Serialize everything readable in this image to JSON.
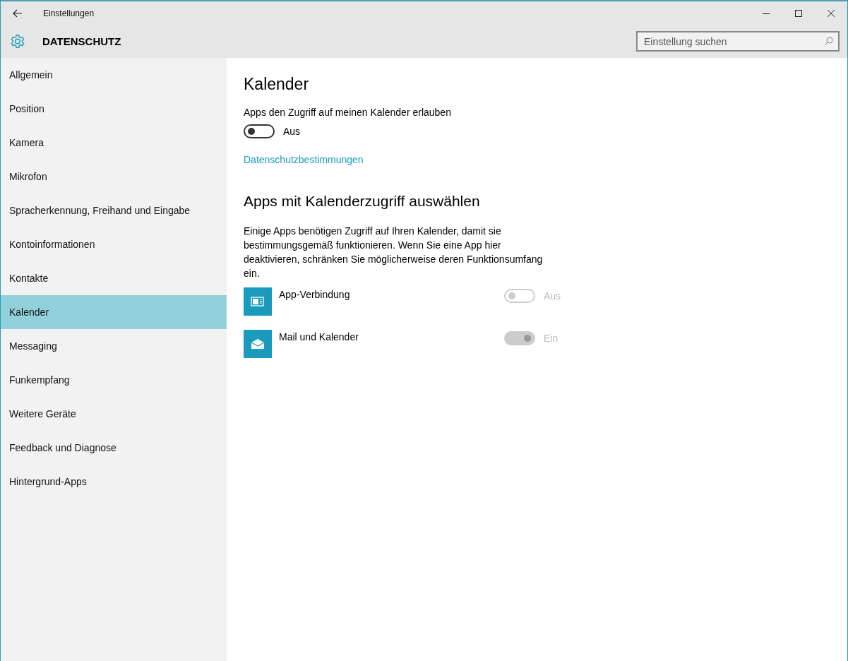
{
  "window": {
    "title": "Einstellungen"
  },
  "header": {
    "title": "DATENSCHUTZ",
    "search": {
      "placeholder": "Einstellung suchen"
    }
  },
  "sidebar": {
    "items": [
      {
        "label": "Allgemein",
        "selected": false
      },
      {
        "label": "Position",
        "selected": false
      },
      {
        "label": "Kamera",
        "selected": false
      },
      {
        "label": "Mikrofon",
        "selected": false
      },
      {
        "label": "Spracherkennung, Freihand und Eingabe",
        "selected": false
      },
      {
        "label": "Kontoinformationen",
        "selected": false
      },
      {
        "label": "Kontakte",
        "selected": false
      },
      {
        "label": "Kalender",
        "selected": true
      },
      {
        "label": "Messaging",
        "selected": false
      },
      {
        "label": "Funkempfang",
        "selected": false
      },
      {
        "label": "Weitere Geräte",
        "selected": false
      },
      {
        "label": "Feedback und Diagnose",
        "selected": false
      },
      {
        "label": "Hintergrund-Apps",
        "selected": false
      }
    ]
  },
  "content": {
    "title": "Kalender",
    "main_toggle": {
      "label": "Apps den Zugriff auf meinen Kalender erlauben",
      "on": false,
      "disabled": false,
      "state_text": "Aus"
    },
    "link": "Datenschutzbestimmungen",
    "section_title": "Apps mit Kalenderzugriff auswählen",
    "description": "Einige Apps benötigen Zugriff auf Ihren Kalender, damit sie bestimmungsgemäß funktionieren. Wenn Sie eine App hier deaktivieren, schränken Sie möglicherweise deren Funktionsumfang ein.",
    "apps": [
      {
        "kind": "connector",
        "name": "App-Verbindung",
        "on": false,
        "disabled": true,
        "state_text": "Aus"
      },
      {
        "kind": "mail",
        "name": "Mail und Kalender",
        "on": true,
        "disabled": true,
        "state_text": "Ein"
      }
    ]
  }
}
